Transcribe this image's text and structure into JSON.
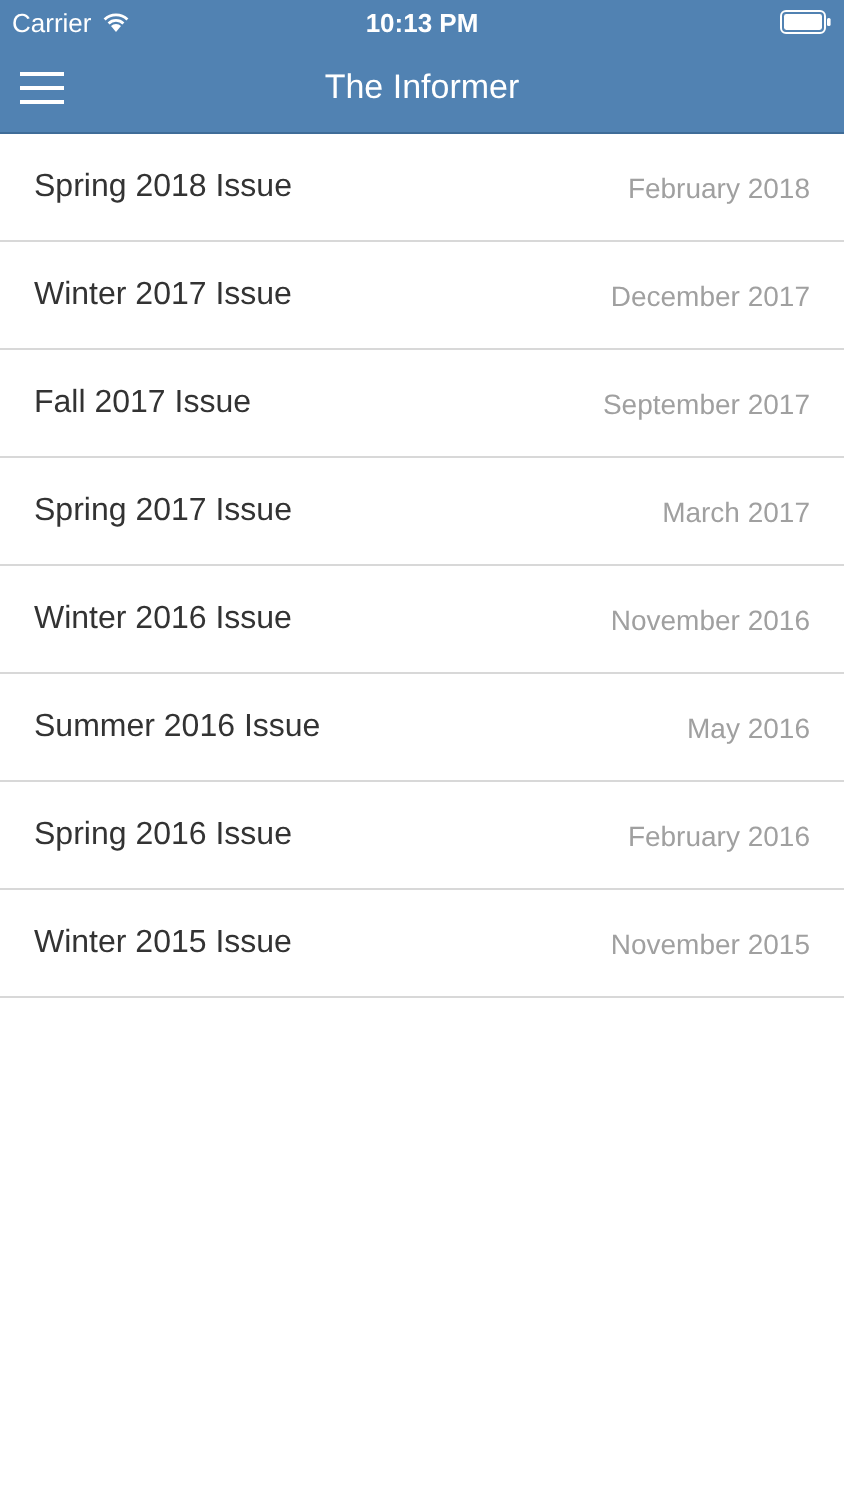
{
  "status_bar": {
    "carrier": "Carrier",
    "time": "10:13 PM"
  },
  "nav_bar": {
    "title": "The Informer"
  },
  "issues": [
    {
      "title": "Spring 2018 Issue",
      "date": "February 2018"
    },
    {
      "title": "Winter 2017 Issue",
      "date": "December 2017"
    },
    {
      "title": "Fall 2017 Issue",
      "date": "September 2017"
    },
    {
      "title": "Spring 2017 Issue",
      "date": "March 2017"
    },
    {
      "title": "Winter 2016 Issue",
      "date": "November 2016"
    },
    {
      "title": "Summer 2016 Issue",
      "date": "May 2016"
    },
    {
      "title": "Spring 2016 Issue",
      "date": "February 2016"
    },
    {
      "title": "Winter 2015 Issue",
      "date": "November 2015"
    }
  ]
}
